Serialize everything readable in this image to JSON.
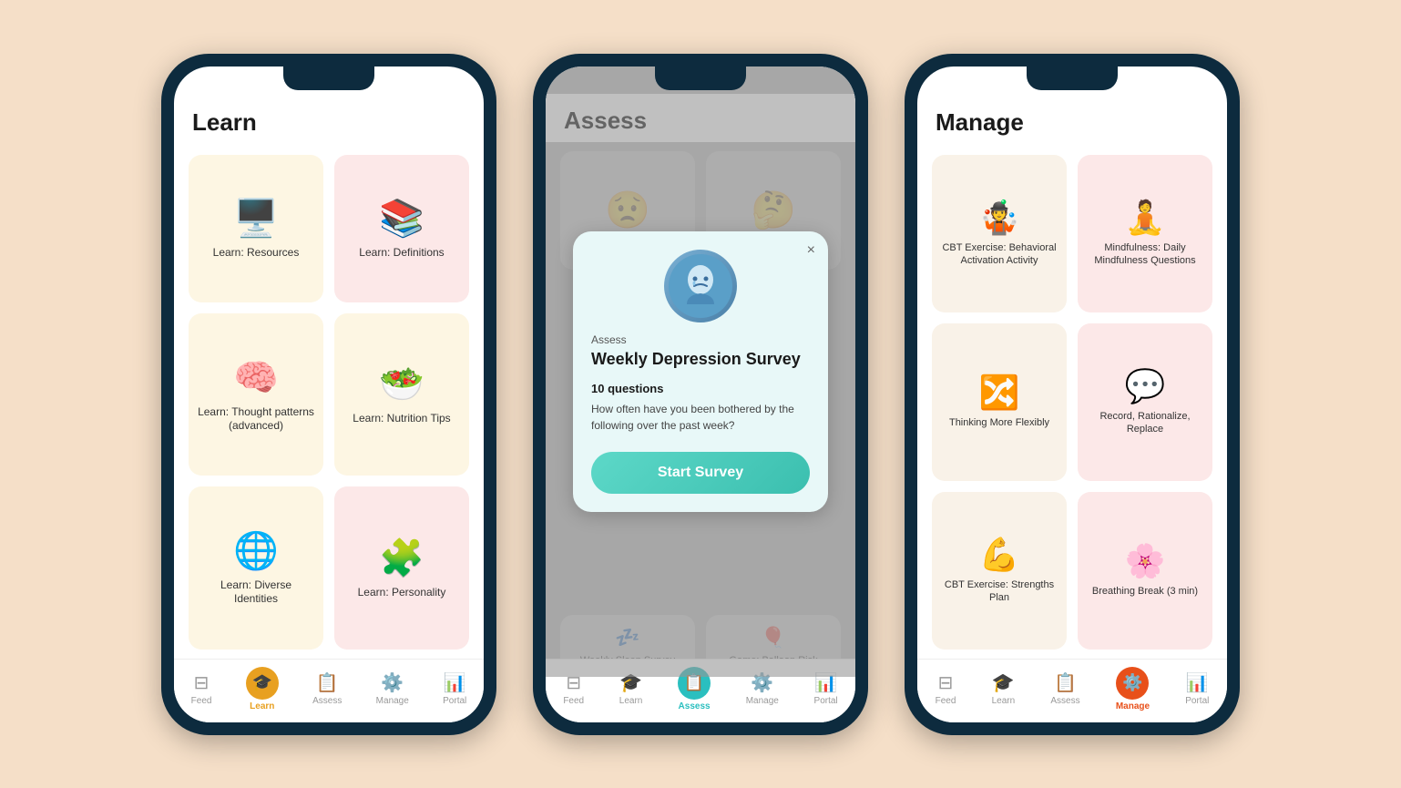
{
  "bg_color": "#f5dfc8",
  "phone1": {
    "title": "Learn",
    "cards": [
      {
        "label": "Learn: Resources",
        "icon": "🖥️",
        "color": "yellow"
      },
      {
        "label": "Learn: Definitions",
        "icon": "📚",
        "color": "pink"
      },
      {
        "label": "Learn: Thought patterns (advanced)",
        "icon": "🧠",
        "color": "yellow"
      },
      {
        "label": "Learn: Nutrition Tips",
        "icon": "🥗",
        "color": "yellow"
      },
      {
        "label": "Learn: Diverse Identities",
        "icon": "🌐",
        "color": "yellow"
      },
      {
        "label": "Learn: Personality",
        "icon": "🧩",
        "color": "pink"
      }
    ],
    "nav": [
      {
        "label": "Feed",
        "icon": "☰",
        "active": false
      },
      {
        "label": "Learn",
        "icon": "🎓",
        "active": true
      },
      {
        "label": "Assess",
        "icon": "📋",
        "active": false
      },
      {
        "label": "Manage",
        "icon": "⚙️",
        "active": false
      },
      {
        "label": "Portal",
        "icon": "📊",
        "active": false
      }
    ]
  },
  "phone2": {
    "title": "Assess",
    "modal": {
      "category": "Assess",
      "title": "Weekly Depression Survey",
      "questions_label": "10 questions",
      "description": "How often have you been bothered by the following over the past week?",
      "button_label": "Start Survey",
      "close_label": "×"
    },
    "bg_cards": [
      {
        "icon": "😟",
        "label": ""
      },
      {
        "icon": "🤔",
        "label": ""
      }
    ],
    "bottom_cards": [
      {
        "label": "Weekly Sleep Survey"
      },
      {
        "label": "Game: Balloon Risk"
      }
    ],
    "nav": [
      {
        "label": "Feed",
        "icon": "☰",
        "active": false
      },
      {
        "label": "Learn",
        "icon": "🎓",
        "active": false
      },
      {
        "label": "Assess",
        "icon": "📋",
        "active": true
      },
      {
        "label": "Manage",
        "icon": "⚙️",
        "active": false
      },
      {
        "label": "Portal",
        "icon": "📊",
        "active": false
      }
    ]
  },
  "phone3": {
    "title": "Manage",
    "cards": [
      {
        "label": "CBT Exercise: Behavioral Activation Activity",
        "icon": "🤹",
        "color": "yellow"
      },
      {
        "label": "Mindfulness: Daily Mindfulness Questions",
        "icon": "🧘",
        "color": "pink"
      },
      {
        "label": "Thinking More Flexibly",
        "icon": "🔀",
        "color": "yellow"
      },
      {
        "label": "Record, Rationalize, Replace",
        "icon": "💬",
        "color": "pink"
      },
      {
        "label": "CBT Exercise: Strengths Plan",
        "icon": "💪",
        "color": "yellow"
      },
      {
        "label": "Breathing Break (3 min)",
        "icon": "🌸",
        "color": "pink"
      }
    ],
    "nav": [
      {
        "label": "Feed",
        "icon": "☰",
        "active": false
      },
      {
        "label": "Learn",
        "icon": "🎓",
        "active": false
      },
      {
        "label": "Assess",
        "icon": "📋",
        "active": false
      },
      {
        "label": "Manage",
        "icon": "⚙️",
        "active": true
      },
      {
        "label": "Portal",
        "icon": "📊",
        "active": false
      }
    ]
  }
}
